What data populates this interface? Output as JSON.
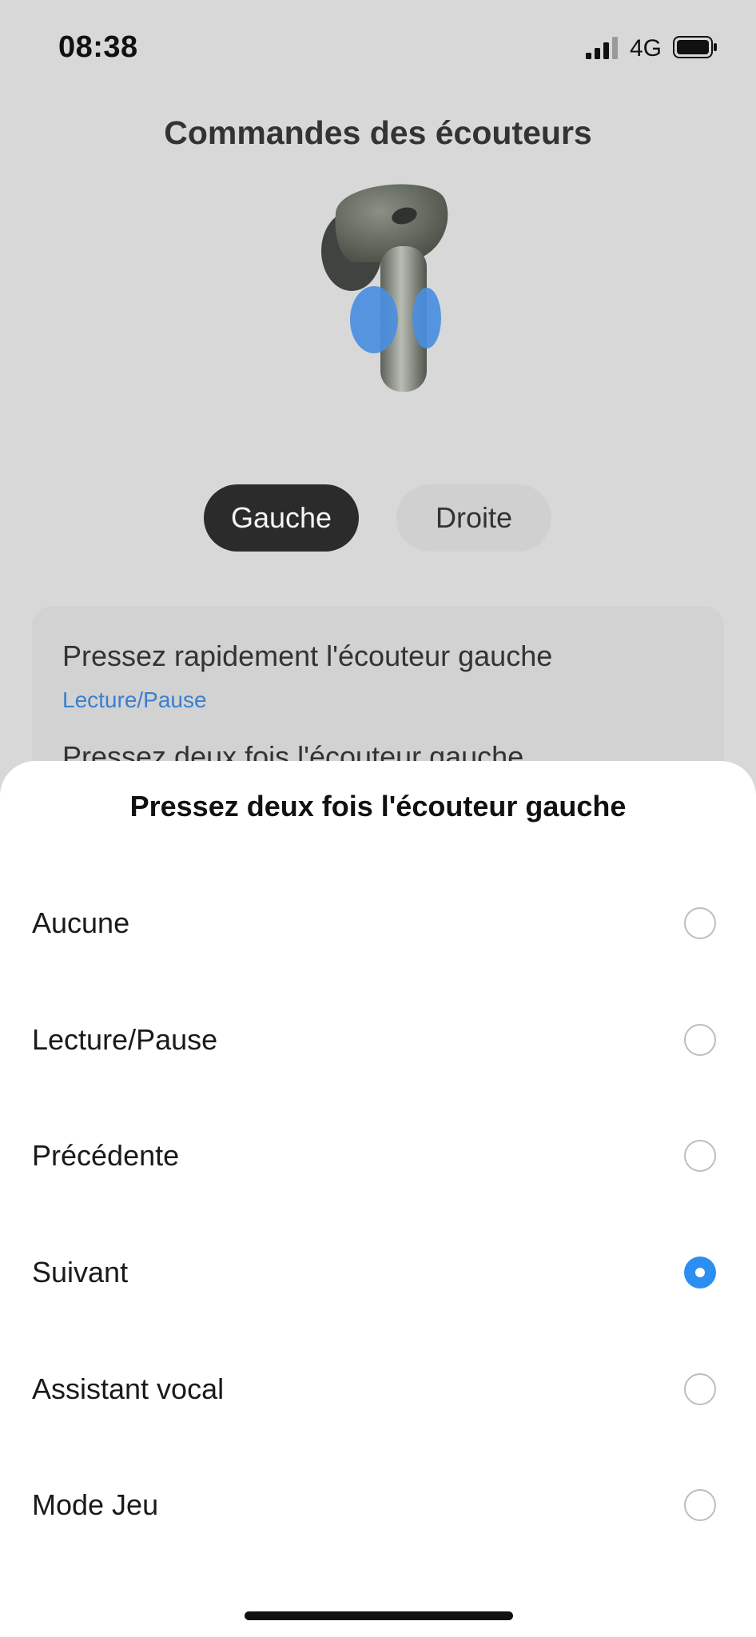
{
  "status_bar": {
    "time": "08:38",
    "network": "4G",
    "icons": [
      "signal-icon",
      "battery-icon"
    ]
  },
  "header": {
    "title": "Commandes des écouteurs"
  },
  "side_toggle": {
    "left_label": "Gauche",
    "right_label": "Droite",
    "selected": "Gauche"
  },
  "card": {
    "item1_title": "Pressez rapidement l'écouteur gauche",
    "item1_value": "Lecture/Pause",
    "item2_title": "Pressez deux fois l'écouteur gauche"
  },
  "sheet": {
    "title": "Pressez deux fois l'écouteur gauche",
    "options": [
      {
        "label": "Aucune",
        "selected": false
      },
      {
        "label": "Lecture/Pause",
        "selected": false
      },
      {
        "label": "Précédente",
        "selected": false
      },
      {
        "label": "Suivant",
        "selected": true
      },
      {
        "label": "Assistant vocal",
        "selected": false
      },
      {
        "label": "Mode Jeu",
        "selected": false
      }
    ]
  },
  "colors": {
    "accent": "#2b8ef2",
    "link": "#3a7fd0",
    "active_pill": "#2b2b2b",
    "background": "#d8d8d8"
  }
}
